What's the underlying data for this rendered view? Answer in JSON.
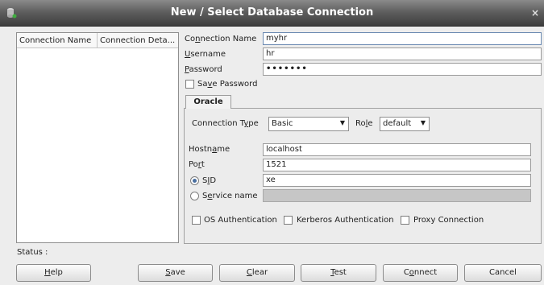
{
  "window": {
    "title": "New / Select Database Connection",
    "close_glyph": "×"
  },
  "list": {
    "col1": "Connection Name",
    "col2": "Connection Deta..."
  },
  "form": {
    "conn_name": {
      "pre": "Co",
      "acc": "n",
      "post": "nection Name",
      "value": "myhr"
    },
    "username": {
      "pre": "",
      "acc": "U",
      "post": "sername",
      "value": "hr"
    },
    "password": {
      "pre": "",
      "acc": "P",
      "post": "assword",
      "value": "•••••••"
    },
    "save_password": {
      "pre": "Sa",
      "acc": "v",
      "post": "e Password"
    }
  },
  "tab": {
    "label": "Oracle"
  },
  "oracle": {
    "conn_type": {
      "pre": "Connection T",
      "acc": "y",
      "post": "pe",
      "value": "Basic"
    },
    "role": {
      "pre": "Ro",
      "acc": "l",
      "post": "e",
      "value": "default"
    },
    "hostname": {
      "pre": "Hostn",
      "acc": "a",
      "post": "me",
      "value": "localhost"
    },
    "port": {
      "pre": "Po",
      "acc": "r",
      "post": "t",
      "value": "1521"
    },
    "sid": {
      "pre": "S",
      "acc": "I",
      "post": "D",
      "value": "xe"
    },
    "service": {
      "pre": "S",
      "acc": "e",
      "post": "rvice name",
      "value": ""
    },
    "os_auth": "OS Authentication",
    "kerberos_auth": "Kerberos Authentication",
    "proxy_conn": "Proxy Connection"
  },
  "status": {
    "label": "Status :"
  },
  "buttons": {
    "help": {
      "acc": "H",
      "post": "elp"
    },
    "save": {
      "acc": "S",
      "post": "ave"
    },
    "clear": {
      "acc": "C",
      "post": "lear"
    },
    "test": {
      "acc": "T",
      "post": "est"
    },
    "connect": {
      "pre": "C",
      "acc": "o",
      "post": "nnect"
    },
    "cancel": {
      "label": "Cancel"
    }
  },
  "colors": {
    "title_bar": "#4a4a4a",
    "disabled_field": "#c6c6c6"
  }
}
